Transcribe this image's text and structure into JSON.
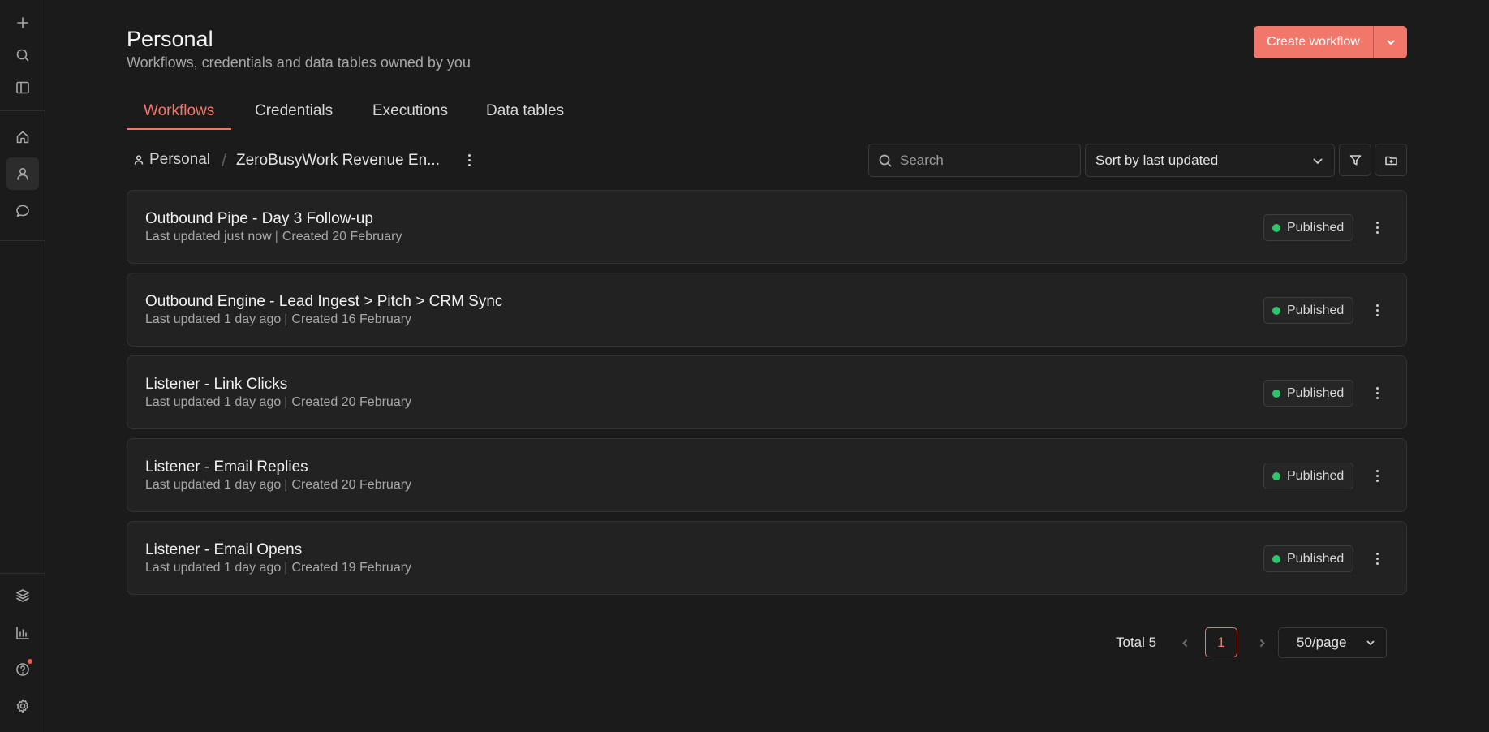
{
  "header": {
    "title": "Personal",
    "subtitle": "Workflows, credentials and data tables owned by you",
    "create_label": "Create workflow"
  },
  "tabs": [
    {
      "label": "Workflows",
      "active": true
    },
    {
      "label": "Credentials",
      "active": false
    },
    {
      "label": "Executions",
      "active": false
    },
    {
      "label": "Data tables",
      "active": false
    }
  ],
  "breadcrumb": {
    "root": "Personal",
    "project": "ZeroBusyWork Revenue En..."
  },
  "toolbar": {
    "search_placeholder": "Search",
    "sort_value": "Sort by last updated"
  },
  "workflows": [
    {
      "name": "Outbound Pipe - Day 3 Follow-up",
      "updated": "Last updated just now",
      "created": "Created 20 February",
      "status": "Published"
    },
    {
      "name": "Outbound Engine - Lead Ingest > Pitch > CRM Sync",
      "updated": "Last updated 1 day ago",
      "created": "Created 16 February",
      "status": "Published"
    },
    {
      "name": "Listener - Link Clicks",
      "updated": "Last updated 1 day ago",
      "created": "Created 20 February",
      "status": "Published"
    },
    {
      "name": "Listener - Email Replies",
      "updated": "Last updated 1 day ago",
      "created": "Created 20 February",
      "status": "Published"
    },
    {
      "name": "Listener - Email Opens",
      "updated": "Last updated 1 day ago",
      "created": "Created 19 February",
      "status": "Published"
    }
  ],
  "pagination": {
    "total": "Total 5",
    "current_page": "1",
    "per_page": "50/page"
  },
  "sidebar_icons": [
    "plus-icon",
    "search-icon",
    "panel-toggle-icon",
    "home-icon",
    "user-icon",
    "chat-icon",
    "templates-icon",
    "insights-icon",
    "help-icon",
    "settings-icon"
  ],
  "colors": {
    "accent": "#f0776a",
    "published_dot": "#2fc46c",
    "background": "#1b1b1b",
    "card": "#222222"
  }
}
